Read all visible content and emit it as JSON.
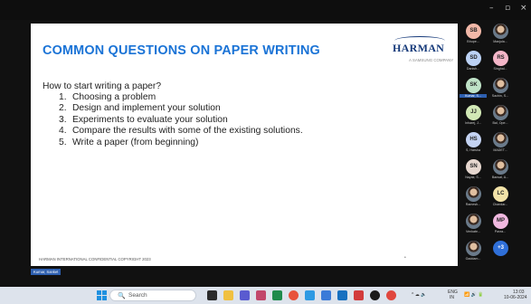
{
  "window": {
    "minimize_glyph": "–",
    "restore_glyph": "▫",
    "close_glyph": "×"
  },
  "slide": {
    "title": "COMMON QUESTIONS ON PAPER WRITING",
    "logo_text": "HARMAN",
    "logo_subtext": "A SAMSUNG COMPANY",
    "question": "How to start writing a paper?",
    "steps": [
      {
        "num": "1.",
        "text": "Choosing a problem"
      },
      {
        "num": "2.",
        "text": "Design and implement your solution"
      },
      {
        "num": "3.",
        "text": "Experiments to evaluate your solution"
      },
      {
        "num": "4.",
        "text": "Compare the results with some of the existing solutions."
      },
      {
        "num": "5.",
        "text": "Write a paper (from beginning)"
      }
    ],
    "footer": "HARMAN INTERNATIONAL CONFIDENTIAL COPYRIGHT 2023",
    "page_marker": "•"
  },
  "participants": [
    {
      "initials": "SB",
      "name": "Bhupe...",
      "color": "#f2b8a8"
    },
    {
      "initials": "",
      "name": "Manjula...",
      "color": ""
    },
    {
      "initials": "SD",
      "name": "Danish...",
      "color": "#bcd2f5"
    },
    {
      "initials": "RS",
      "name": "Singhal...",
      "color": "#f4b6c8"
    },
    {
      "initials": "SK",
      "name": "Kumar, S...",
      "color": "#bfe3c7",
      "highlight": true
    },
    {
      "initials": "",
      "name": "Sachin, S...",
      "color": ""
    },
    {
      "initials": "JJ",
      "name": "Inharej, J...",
      "color": "#d2e9b6"
    },
    {
      "initials": "",
      "name": "Bal, Ope...",
      "color": ""
    },
    {
      "initials": "HS",
      "name": "S, Harsha",
      "color": "#c4d3f3"
    },
    {
      "initials": "",
      "name": "MADET...",
      "color": ""
    },
    {
      "initials": "SN",
      "name": "Nayak, S...",
      "color": "#e6d7cf"
    },
    {
      "initials": "",
      "name": "Bansal, A...",
      "color": ""
    },
    {
      "initials": "",
      "name": "Ramesh...",
      "color": ""
    },
    {
      "initials": "LC",
      "name": "Chandar...",
      "color": "#f3e3a8"
    },
    {
      "initials": "",
      "name": "Venkate...",
      "color": ""
    },
    {
      "initials": "MP",
      "name": "Pavra...",
      "color": "#f0b8df"
    },
    {
      "initials": "",
      "name": "Gaddam...",
      "color": ""
    },
    {
      "initials": "+3",
      "name": "",
      "color": "#2f6fd8"
    }
  ],
  "speaker_label": "Kumar, Sanket",
  "taskbar": {
    "search_placeholder": "Search",
    "search_icon": "🔍",
    "tray_lang_line1": "ENG",
    "tray_lang_line2": "IN",
    "tray_icons": "^ ☁ 🔈",
    "tray_net": "📶 🔊 🔋",
    "time": "13:03",
    "date": "10-06-2024"
  }
}
